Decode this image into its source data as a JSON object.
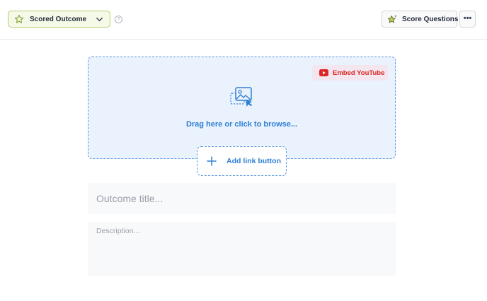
{
  "header": {
    "outcome_select": {
      "label": "Scored Outcome",
      "icon": "star-icon"
    },
    "help_icon": "?",
    "score_button": {
      "label": "Score Questions",
      "icon": "star-sparkle-icon"
    },
    "more_button": "•••"
  },
  "dropzone": {
    "embed_youtube": {
      "label": "Embed YouTube",
      "icon": "youtube-icon"
    },
    "prompt": "Drag here or click to browse...",
    "icon": "image-upload-icon"
  },
  "add_link_button": {
    "label": "Add link button",
    "icon": "plus-icon"
  },
  "form": {
    "title_placeholder": "Outcome title...",
    "description_placeholder": "Description..."
  },
  "colors": {
    "accent_blue": "#2f7fd5",
    "dropzone_bg": "#eaf2fd",
    "outcome_border": "#b5cf72",
    "youtube_red": "#dc2626"
  }
}
